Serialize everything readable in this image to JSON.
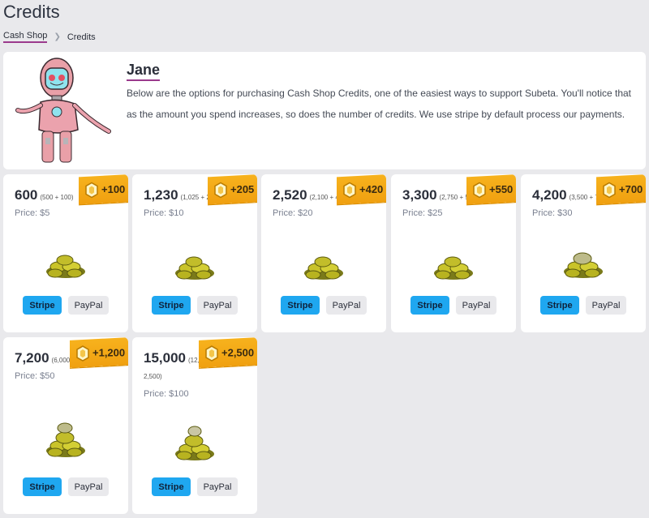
{
  "header": {
    "title": "Credits",
    "breadcrumb": [
      {
        "label": "Cash Shop"
      },
      {
        "label": "Credits"
      }
    ]
  },
  "intro": {
    "name": "Jane",
    "text": "Below are the options for purchasing Cash Shop Credits, one of the easiest ways to support Subeta. You'll notice that as the amount you spend increases, so does the number of credits. We use stripe by default process our payments."
  },
  "colors": {
    "accent_underline": "#9b3a8c",
    "stripe_button": "#1fa7f0",
    "bonus_ribbon": "#f7b21d"
  },
  "packages": [
    {
      "credits": "600",
      "breakdown": "(500 + 100)",
      "price": "Price: $5",
      "bonus": "+100",
      "stripe": "Stripe",
      "paypal": "PayPal"
    },
    {
      "credits": "1,230",
      "breakdown": "(1,025 + 205)",
      "price": "Price: $10",
      "bonus": "+205",
      "stripe": "Stripe",
      "paypal": "PayPal"
    },
    {
      "credits": "2,520",
      "breakdown": "(2,100 + 420)",
      "price": "Price: $20",
      "bonus": "+420",
      "stripe": "Stripe",
      "paypal": "PayPal"
    },
    {
      "credits": "3,300",
      "breakdown": "(2,750 + 550)",
      "price": "Price: $25",
      "bonus": "+550",
      "stripe": "Stripe",
      "paypal": "PayPal"
    },
    {
      "credits": "4,200",
      "breakdown": "(3,500 + 700)",
      "price": "Price: $30",
      "bonus": "+700",
      "stripe": "Stripe",
      "paypal": "PayPal"
    },
    {
      "credits": "7,200",
      "breakdown": "(6,000 + 1,200)",
      "price": "Price: $50",
      "bonus": "+1,200",
      "stripe": "Stripe",
      "paypal": "PayPal"
    },
    {
      "credits": "15,000",
      "breakdown": "(12,500 +",
      "breakdown_2": "2,500)",
      "price": "Price: $100",
      "bonus": "+2,500",
      "stripe": "Stripe",
      "paypal": "PayPal"
    }
  ]
}
